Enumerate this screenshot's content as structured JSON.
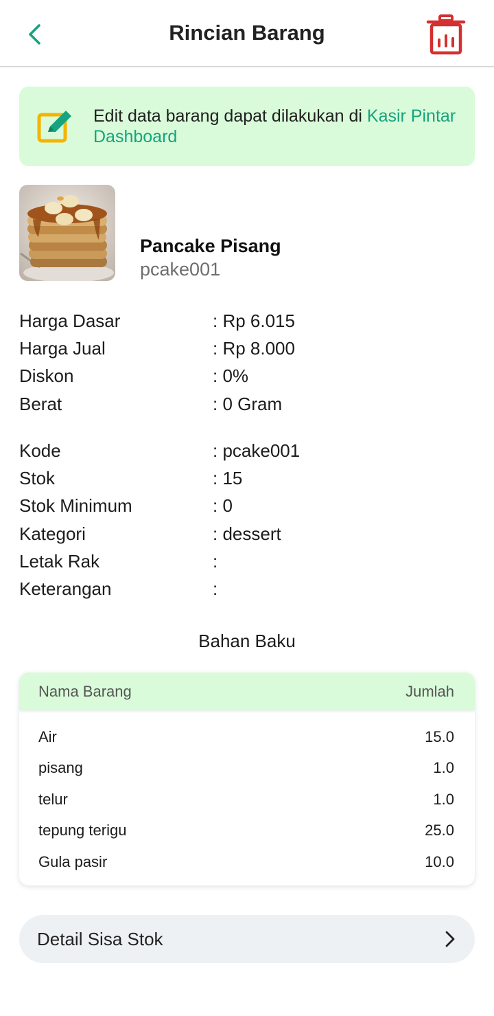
{
  "header": {
    "title": "Rincian Barang"
  },
  "banner": {
    "text": "Edit data barang dapat dilakukan di ",
    "link_text": "Kasir Pintar Dashboard"
  },
  "product": {
    "name": "Pancake Pisang",
    "code": "pcake001"
  },
  "details": [
    {
      "label": "Harga Dasar",
      "value": ": Rp 6.015"
    },
    {
      "label": "Harga Jual",
      "value": ": Rp 8.000"
    },
    {
      "label": "Diskon",
      "value": ": 0%"
    },
    {
      "label": "Berat",
      "value": ": 0 Gram"
    },
    {
      "label": "Kode",
      "value": ": pcake001"
    },
    {
      "label": "Stok",
      "value": ": 15"
    },
    {
      "label": "Stok Minimum",
      "value": ": 0"
    },
    {
      "label": "Kategori",
      "value": ": dessert"
    },
    {
      "label": "Letak Rak",
      "value": ":"
    },
    {
      "label": "Keterangan",
      "value": ":"
    }
  ],
  "materials": {
    "title": "Bahan Baku",
    "col_name": "Nama Barang",
    "col_qty": "Jumlah",
    "rows": [
      {
        "name": "Air",
        "qty": "15.0"
      },
      {
        "name": "pisang",
        "qty": "1.0"
      },
      {
        "name": "telur",
        "qty": "1.0"
      },
      {
        "name": "tepung terigu",
        "qty": "25.0"
      },
      {
        "name": "Gula pasir",
        "qty": "10.0"
      }
    ]
  },
  "stock_button": {
    "label": "Detail Sisa Stok"
  },
  "colors": {
    "accent_green": "#16a37f",
    "banner_bg": "#d9fbd9",
    "delete_red": "#d3302f",
    "edit_icon_orange": "#f4b400"
  },
  "icons": {
    "back": "chevron-left-icon",
    "delete": "trash-icon",
    "banner": "edit-icon",
    "stock_chevron": "chevron-right-icon"
  }
}
